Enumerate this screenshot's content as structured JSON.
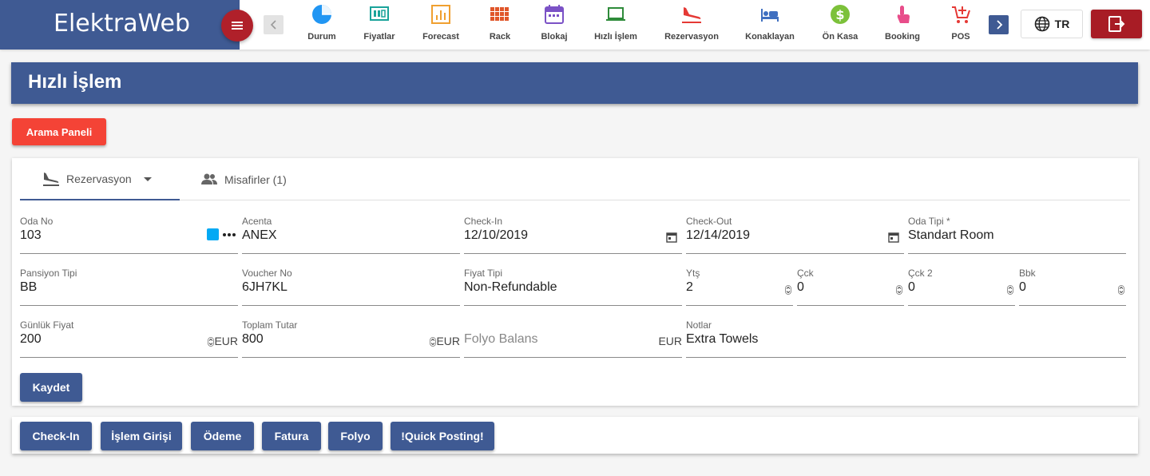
{
  "app": {
    "brand": "ElektraWeb"
  },
  "nav": {
    "items": [
      {
        "label": "Durum",
        "icon": "pie-chart-icon",
        "color": "#2196f3"
      },
      {
        "label": "Fiyatlar",
        "icon": "price-tag-icon",
        "color": "#1aa39a"
      },
      {
        "label": "Forecast",
        "icon": "bar-chart-icon",
        "color": "#f0a030"
      },
      {
        "label": "Rack",
        "icon": "grid-icon",
        "color": "#e0562a"
      },
      {
        "label": "Blokaj",
        "icon": "calendar-icon",
        "color": "#7b52c6"
      },
      {
        "label": "Hızlı İşlem",
        "icon": "laptop-icon",
        "color": "#2e8b3a"
      },
      {
        "label": "Rezervasyon",
        "icon": "plane-landing-icon",
        "color": "#e53935"
      },
      {
        "label": "Konaklayan",
        "icon": "bed-icon",
        "color": "#3f6fc0"
      },
      {
        "label": "Ön Kasa",
        "icon": "dollar-coin-icon",
        "color": "#7cc13a"
      },
      {
        "label": "Booking",
        "icon": "touch-icon",
        "color": "#e84d8a"
      },
      {
        "label": "POS",
        "icon": "cart-plus-icon",
        "color": "#e53935"
      }
    ],
    "lang": "TR"
  },
  "page": {
    "title": "Hızlı İşlem",
    "search_button": "Arama Paneli"
  },
  "tabs": [
    {
      "label": "Rezervasyon"
    },
    {
      "label": "Misafirler (1)"
    }
  ],
  "form": {
    "oda_no": {
      "label": "Oda No",
      "value": "103"
    },
    "acenta": {
      "label": "Acenta",
      "value": "ANEX"
    },
    "check_in": {
      "label": "Check-In",
      "value": "12/10/2019"
    },
    "check_out": {
      "label": "Check-Out",
      "value": "12/14/2019"
    },
    "oda_tipi": {
      "label": "Oda Tipi *",
      "value": "Standart Room"
    },
    "pansiyon_tipi": {
      "label": "Pansiyon Tipi",
      "value": "BB"
    },
    "voucher_no": {
      "label": "Voucher No",
      "value": "6JH7KL"
    },
    "fiyat_tipi": {
      "label": "Fiyat Tipi",
      "value": "Non-Refundable"
    },
    "yts": {
      "label": "Ytş",
      "value": "2"
    },
    "cck": {
      "label": "Çck",
      "value": "0"
    },
    "cck2": {
      "label": "Çck 2",
      "value": "0"
    },
    "bbk": {
      "label": "Bbk",
      "value": "0"
    },
    "gunluk_fiyat": {
      "label": "Günlük Fiyat",
      "value": "200",
      "currency": "EUR"
    },
    "toplam_tutar": {
      "label": "Toplam Tutar",
      "value": "800",
      "currency": "EUR"
    },
    "folyo_balans": {
      "placeholder": "Folyo Balans",
      "currency": "EUR"
    },
    "notlar": {
      "label": "Notlar",
      "value": "Extra Towels"
    },
    "save_button": "Kaydet"
  },
  "actions": [
    "Check-In",
    "İşlem Girişi",
    "Ödeme",
    "Fatura",
    "Folyo",
    "!Quick Posting!"
  ],
  "colors": {
    "primary": "#3f5a93",
    "danger": "#f44336",
    "logout": "#a81c25",
    "room_color": "#03a9f4"
  }
}
